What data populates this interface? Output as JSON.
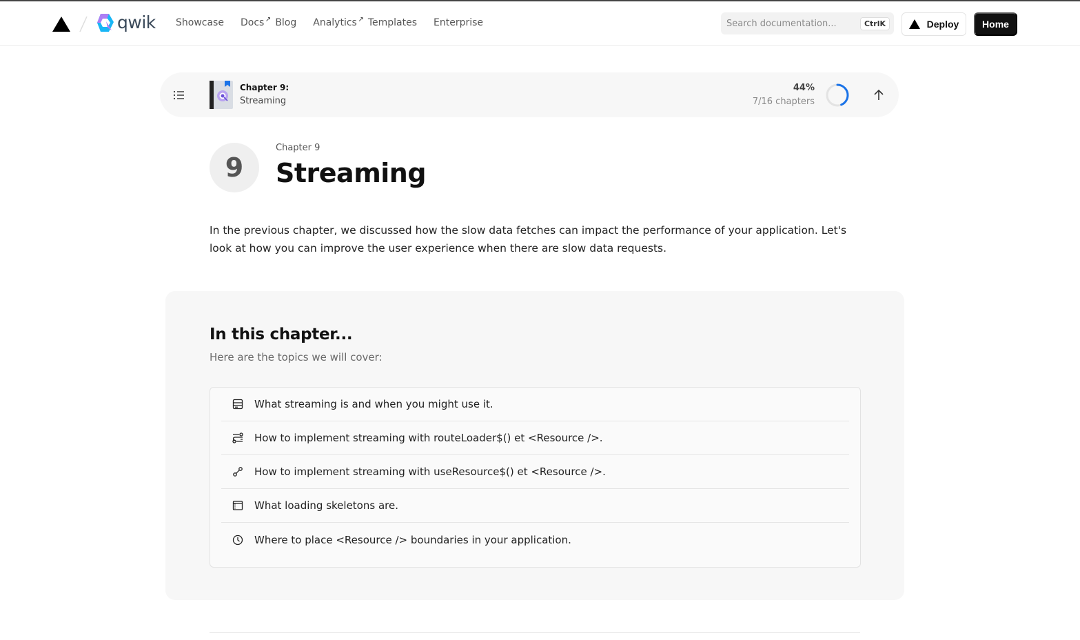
{
  "header": {
    "brand": "qwik",
    "nav": [
      {
        "label": "Showcase",
        "external": false
      },
      {
        "label": "Docs",
        "external": true
      },
      {
        "label": "Blog",
        "external": false
      },
      {
        "label": "Analytics",
        "external": true
      },
      {
        "label": "Templates",
        "external": false
      },
      {
        "label": "Enterprise",
        "external": false
      }
    ],
    "search_placeholder": "Search documentation...",
    "search_shortcut": "CtrlK",
    "deploy_label": "Deploy",
    "home_label": "Home"
  },
  "chapter_bar": {
    "chapter_label": "Chapter 9:",
    "chapter_name": "Streaming",
    "percent": "44%",
    "progress_fraction": 0.4375,
    "chapters_count": "7/16 chapters"
  },
  "chapter": {
    "number": "9",
    "eyebrow": "Chapter 9",
    "title": "Streaming",
    "intro": "In the previous chapter, we discussed how the slow data fetches can impact the performance of your application. Let's look at how you can improve the user experience when there are slow data requests."
  },
  "in_this_chapter": {
    "title": "In this chapter...",
    "subtitle": "Here are the topics we will cover:",
    "topics": [
      {
        "icon": "server-icon",
        "text": "What streaming is and when you might use it."
      },
      {
        "icon": "route-icon",
        "text": "How to implement streaming with routeLoader$() et <Resource />."
      },
      {
        "icon": "link-icon",
        "text": "How to implement streaming with useResource$() et <Resource />."
      },
      {
        "icon": "window-icon",
        "text": "What loading skeletons are."
      },
      {
        "icon": "clock-icon",
        "text": "Where to place <Resource /> boundaries in your application."
      }
    ]
  },
  "colors": {
    "accent": "#1a73e8",
    "dark": "#111111"
  }
}
